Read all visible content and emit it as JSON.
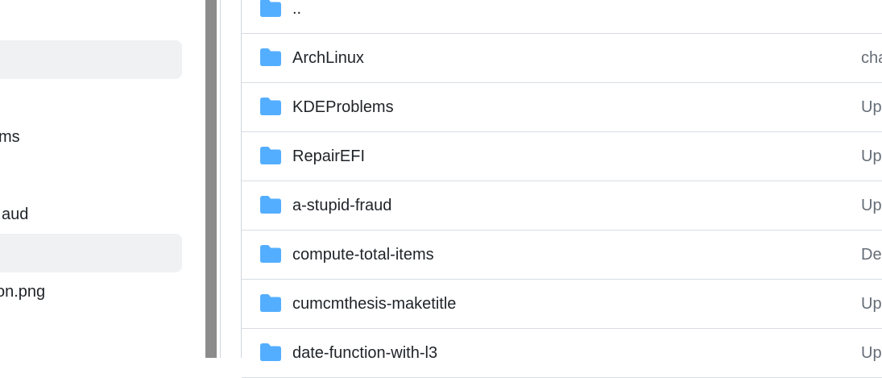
{
  "sidebar": {
    "items": [
      {
        "label": "ms"
      },
      {
        "label": "aud"
      },
      {
        "label": "on.png"
      }
    ]
  },
  "files": [
    {
      "name": "..",
      "message": ""
    },
    {
      "name": "ArchLinux",
      "message": "cha"
    },
    {
      "name": "KDEProblems",
      "message": "Up"
    },
    {
      "name": "RepairEFI",
      "message": "Up"
    },
    {
      "name": "a-stupid-fraud",
      "message": "Up"
    },
    {
      "name": "compute-total-items",
      "message": "De"
    },
    {
      "name": "cumcmthesis-maketitle",
      "message": "Up"
    },
    {
      "name": "date-function-with-l3",
      "message": "Up"
    }
  ],
  "colors": {
    "folder": "#54aeff",
    "highlight": "#eff1f3",
    "splitter": "#8c8c8c"
  },
  "icons": {
    "folder": "folder-icon"
  }
}
